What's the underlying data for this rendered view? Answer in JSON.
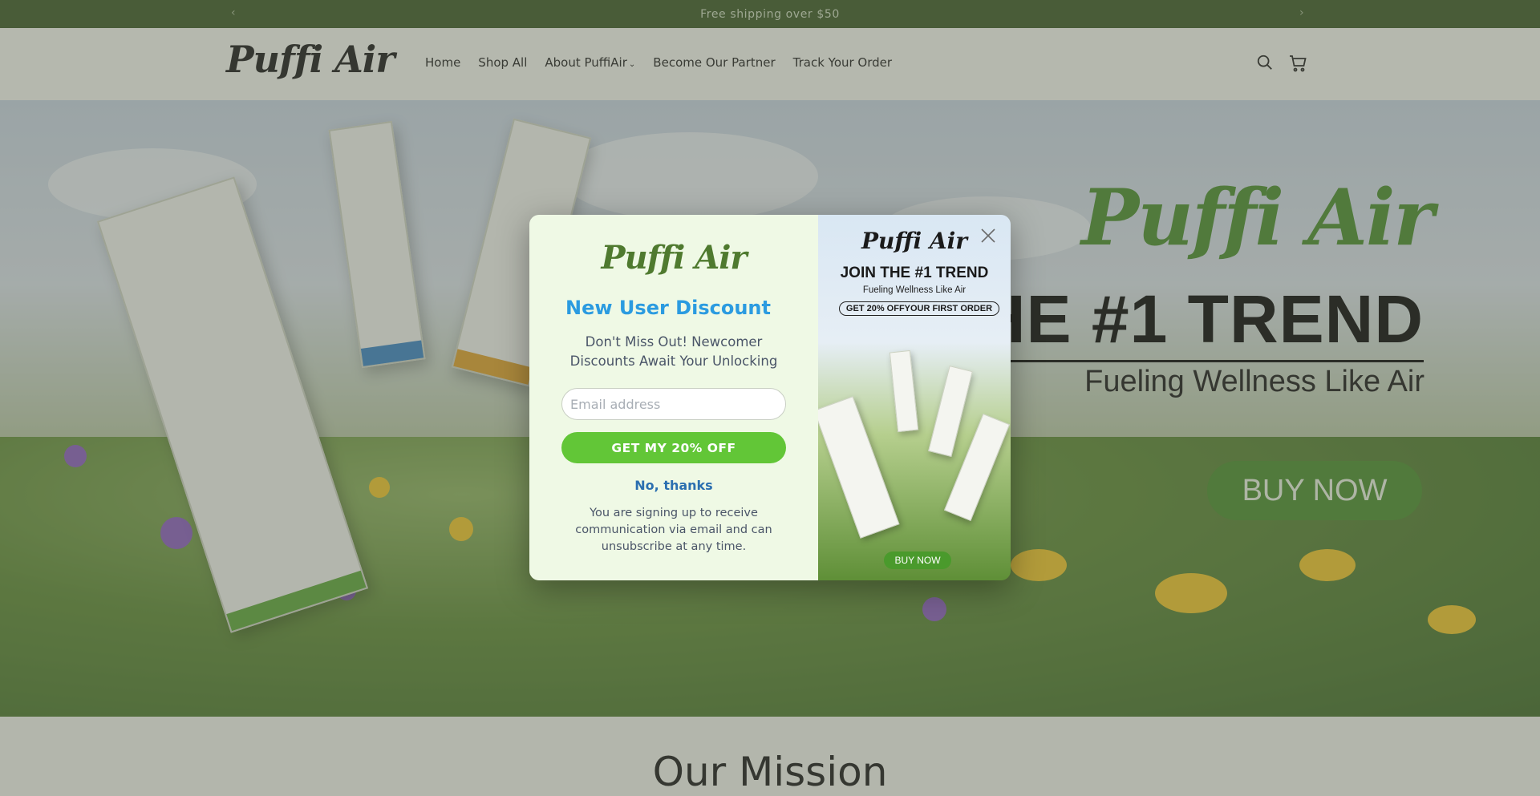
{
  "announcement": {
    "text": "Free shipping over $50",
    "prev_icon": "chevron-left-icon",
    "next_icon": "chevron-right-icon"
  },
  "header": {
    "logo": "Puffi Air",
    "nav": [
      {
        "label": "Home"
      },
      {
        "label": "Shop All"
      },
      {
        "label": "About PuffiAir",
        "has_dropdown": true
      },
      {
        "label": "Become Our Partner"
      },
      {
        "label": "Track Your Order"
      }
    ],
    "icons": [
      "search-icon",
      "cart-icon"
    ]
  },
  "hero": {
    "brand": "Puffi Air",
    "title": "HE #1 TREND",
    "subtitle": "Fueling Wellness Like Air",
    "cta": "BUY NOW"
  },
  "mission": {
    "title": "Our Mission"
  },
  "popup": {
    "logo": "Puffi Air",
    "title": "New User Discount",
    "description": "Don't Miss Out! Newcomer Discounts Await Your Unlocking",
    "email_placeholder": "Email address",
    "email_value": "",
    "submit_label": "GET MY 20% OFF",
    "decline_label": "No, thanks",
    "fine_print": "You are signing up to receive communication via email and can unsubscribe at any time.",
    "image": {
      "logo": "Puffi Air",
      "headline": "JOIN THE #1 TREND",
      "subline": "Fueling Wellness Like Air",
      "offer": "GET 20% OFFYOUR FIRST ORDER",
      "cta": "BUY NOW"
    },
    "close_icon": "close-icon"
  },
  "colors": {
    "announcement_bg": "#3d5a27",
    "brand_green": "#4a8d2d",
    "popup_title_blue": "#2b9be0",
    "popup_button_green": "#62c637",
    "popup_bg": "#eff9e5"
  }
}
